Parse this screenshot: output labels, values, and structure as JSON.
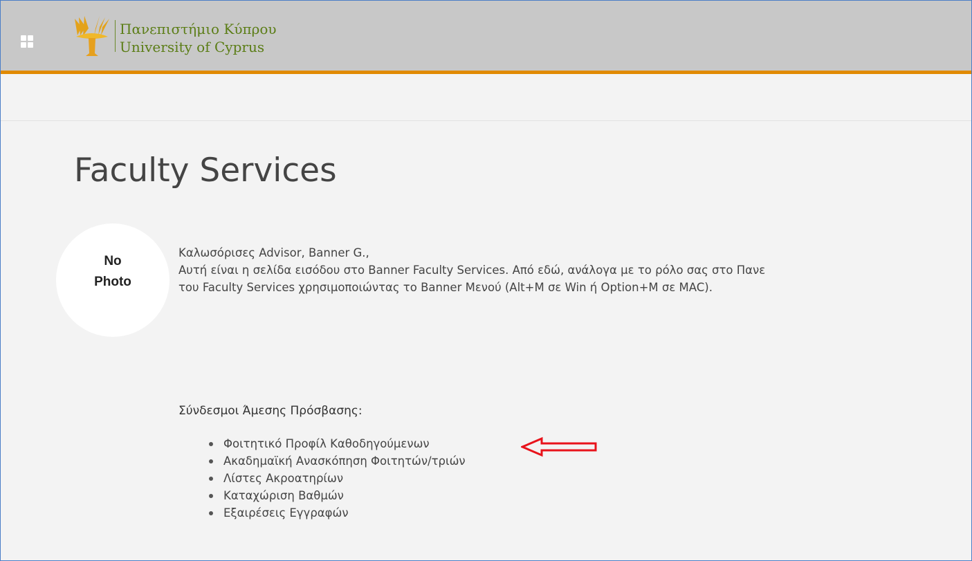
{
  "header": {
    "logo_greek": "Πανεπιστήμιο Κύπρου",
    "logo_english": "University of Cyprus",
    "accent_color": "#e08a00",
    "bar_color": "#c8c8c8",
    "apps_icon": "apps-grid-icon"
  },
  "main": {
    "title": "Faculty Services",
    "avatar_line1": "No",
    "avatar_line2": "Photo",
    "welcome_line1": "Καλωσόρισες Advisor, Banner G.,",
    "welcome_line2": "Αυτή είναι η σελίδα εισόδου στο Banner Faculty Services. Από εδώ, ανάλογα με το ρόλο σας στο Πανε",
    "welcome_line3": "του Faculty Services χρησιμοποιώντας το Banner Μενού (Alt+M σε Win ή Option+M σε MAC).",
    "links_heading": "Σύνδεσμοι Άμεσης Πρόσβασης:",
    "links": [
      "Φοιτητικό Προφίλ Καθοδηγούμενων",
      "Ακαδημαϊκή Ανασκόπηση Φοιτητών/τριών",
      "Λίστες Ακροατηρίων",
      "Καταχώριση Βαθμών",
      "Εξαιρέσεις Εγγραφών"
    ],
    "annotation_color": "#e8131b",
    "annotation_icon": "red-arrow-icon"
  }
}
